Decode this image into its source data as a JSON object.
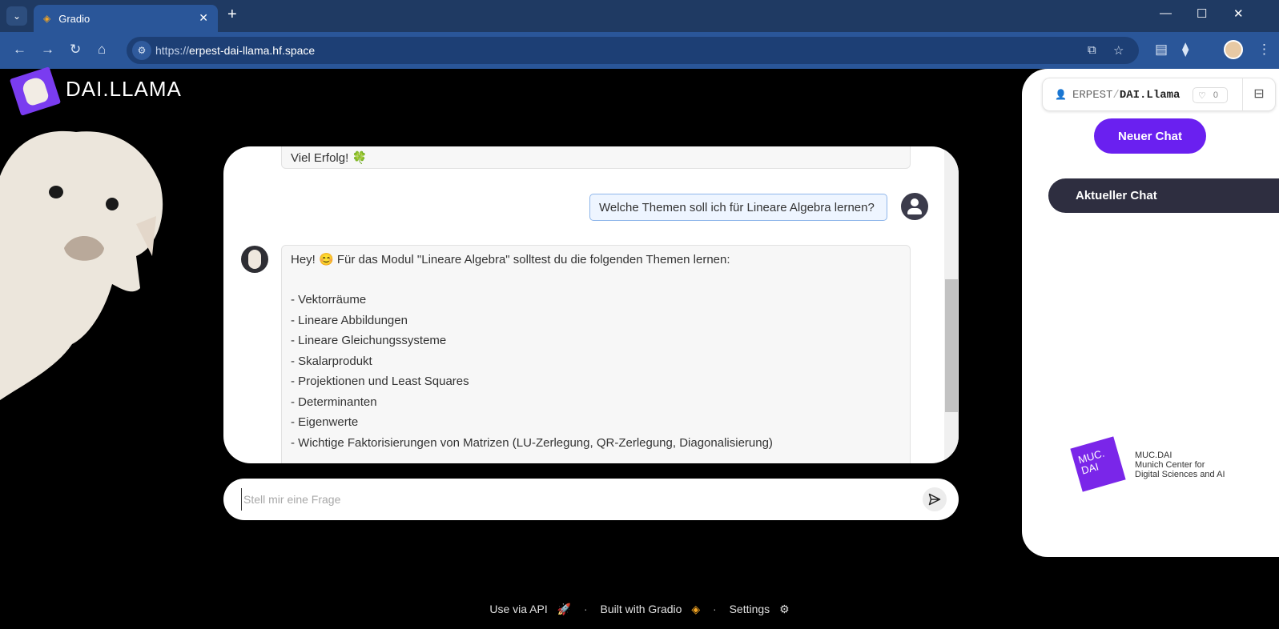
{
  "browser": {
    "tab_title": "Gradio",
    "url_protocol": "https://",
    "url_host": "erpest-dai-llama.hf.space"
  },
  "app": {
    "title": "DAI.LLAMA"
  },
  "chat": {
    "messages": [
      {
        "role": "bot",
        "text": "Viel Erfolg!",
        "emoji": "🍀"
      },
      {
        "role": "user",
        "text": "Welche Themen soll ich für Lineare Algebra lernen?"
      },
      {
        "role": "bot",
        "lines": [
          "Hey! 😊 Für das Modul \"Lineare Algebra\" solltest du die folgenden Themen lernen:",
          "",
          "- Vektorräume",
          "- Lineare Abbildungen",
          "- Lineare Gleichungssysteme",
          "- Skalarprodukt",
          "- Projektionen und Least Squares",
          "- Determinanten",
          "- Eigenwerte",
          "- Wichtige Faktorisierungen von Matrizen (LU-Zerlegung, QR-Zerlegung, Diagonalisierung)"
        ]
      }
    ]
  },
  "input": {
    "placeholder": "Stell mir eine Frage"
  },
  "sidebar": {
    "hf_owner": "ERPEST",
    "hf_repo": "DAI.Llama",
    "hf_likes": "0",
    "new_chat_label": "Neuer Chat",
    "current_chat_label": "Aktueller Chat",
    "muc_logo_text": "MUC.\nDAI",
    "muc_line1": "MUC.DAI",
    "muc_line2": "Munich Center for",
    "muc_line3": "Digital Sciences and AI"
  },
  "footer": {
    "api_label": "Use via API",
    "built_label": "Built with Gradio",
    "settings_label": "Settings"
  },
  "colors": {
    "accent": "#6a20f0",
    "chrome": "#2a5699",
    "current_chat_bg": "#2e2e40"
  }
}
